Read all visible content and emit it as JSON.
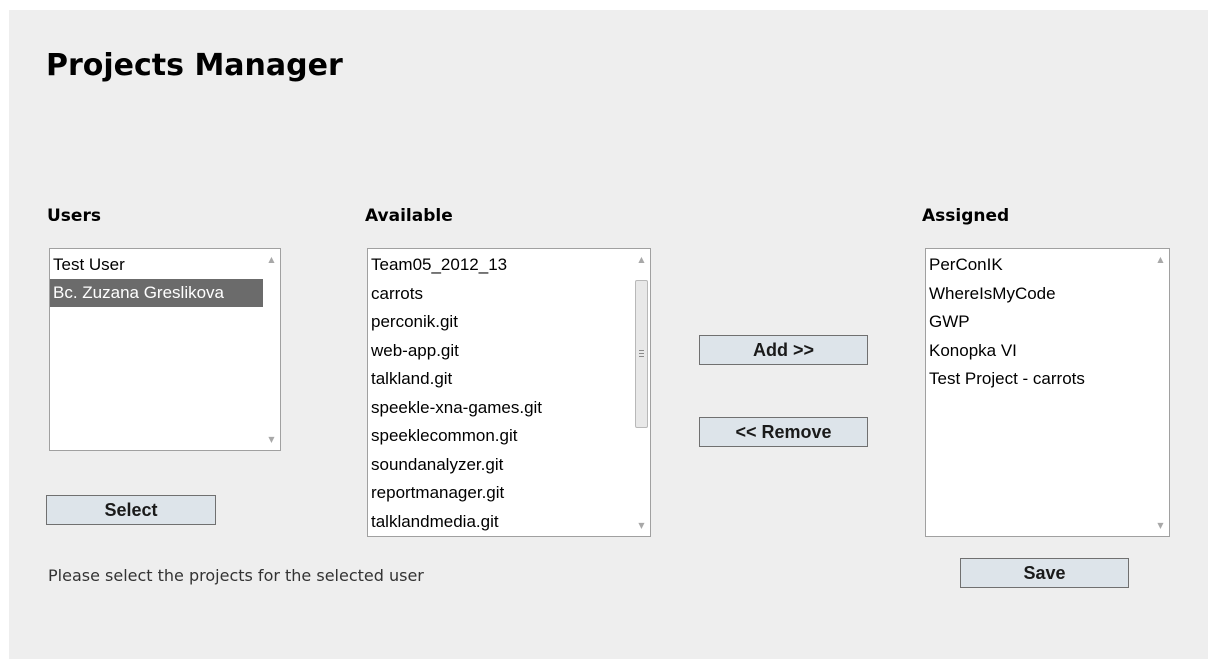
{
  "header": {
    "title": "Projects Manager"
  },
  "users": {
    "label": "Users",
    "items": [
      "Test User",
      "Bc. Zuzana Greslikova"
    ],
    "selected_index": 1,
    "select_button": "Select"
  },
  "available": {
    "label": "Available",
    "items": [
      "Team05_2012_13",
      "carrots",
      "perconik.git",
      "web-app.git",
      "talkland.git",
      "speekle-xna-games.git",
      "speeklecommon.git",
      "soundanalyzer.git",
      "reportmanager.git",
      "talklandmedia.git"
    ]
  },
  "actions": {
    "add_label": "Add >>",
    "remove_label": "<< Remove"
  },
  "assigned": {
    "label": "Assigned",
    "items": [
      "PerConIK",
      "WhereIsMyCode",
      "GWP",
      "Konopka VI",
      "Test Project - carrots"
    ],
    "save_button": "Save"
  },
  "footer": {
    "hint": "Please select the projects for the selected user"
  },
  "colors": {
    "panel_background": "#eeeeee",
    "selected_background": "#6b6b6b",
    "button_background": "#dde4ea"
  },
  "icons": {
    "scroll_up": "chevron-up-icon",
    "scroll_down": "chevron-down-icon"
  }
}
